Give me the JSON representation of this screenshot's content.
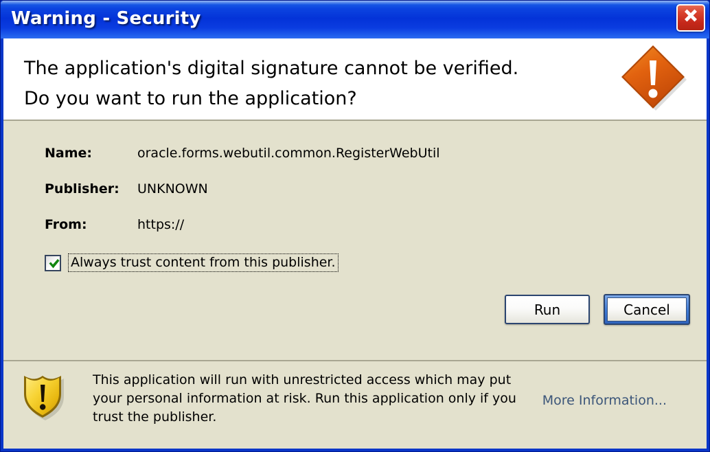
{
  "window": {
    "title": "Warning - Security",
    "close_icon": "close-icon",
    "accent_titlebar_color": "#0433d8",
    "body_color": "#e3e1cd",
    "close_button_color": "#c5281a"
  },
  "header": {
    "message_line1": "The application's digital signature cannot be verified.",
    "message_line2": "Do you want to run the application?",
    "warning_icon": "warning-diamond-icon",
    "warning_icon_color": "#e2620f"
  },
  "details": {
    "fields": [
      {
        "label": "Name:",
        "value": "oracle.forms.webutil.common.RegisterWebUtil"
      },
      {
        "label": "Publisher:",
        "value": "UNKNOWN"
      },
      {
        "label": "From:",
        "value": "https://"
      }
    ],
    "trust_checkbox": {
      "label": "Always trust content from this publisher.",
      "checked": true,
      "check_color": "#12860f"
    }
  },
  "buttons": {
    "run_label": "Run",
    "cancel_label": "Cancel",
    "focused": "Cancel"
  },
  "footer": {
    "shield_icon": "shield-warning-icon",
    "shield_color": "#f5cd2a",
    "warning_line1": "This application will run with unrestricted access which may put",
    "warning_line2": "your personal information at risk. Run this application only if you",
    "warning_line3": "trust the publisher.",
    "more_information_label": "More Information...",
    "link_color": "#3b5579"
  }
}
